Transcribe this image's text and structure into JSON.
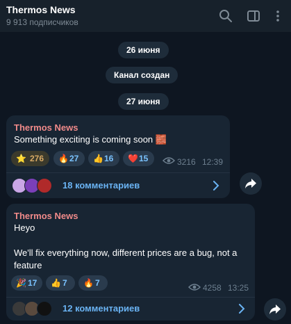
{
  "header": {
    "title": "Thermos News",
    "subtitle": "9 913 подписчиков",
    "icons": [
      "search-icon",
      "sidebar-toggle-icon",
      "more-vert-icon"
    ]
  },
  "date_pills": [
    "26 июня",
    "Канал создан",
    "27 июня"
  ],
  "messages": [
    {
      "sender": "Thermos News",
      "text": "Something exciting is coming soon 🧱",
      "reactions": [
        {
          "emoji": "⭐",
          "count": "276"
        },
        {
          "emoji": "🔥",
          "count": "27"
        },
        {
          "emoji": "👍",
          "count": "16"
        },
        {
          "emoji": "❤️",
          "count": "15"
        }
      ],
      "views": "3216",
      "time": "12:39",
      "comments": "18 комментариев"
    },
    {
      "sender": "Thermos News",
      "text_lines": [
        "Heyo",
        "",
        "We'll fix everything now, different prices are a bug, not a",
        "feature"
      ],
      "reactions": [
        {
          "emoji": "🎉",
          "count": "17"
        },
        {
          "emoji": "👍",
          "count": "7"
        },
        {
          "emoji": "🔥",
          "count": "7"
        }
      ],
      "views": "4258",
      "time": "13:25",
      "comments": "12 комментариев"
    }
  ],
  "colors": {
    "background": "#0e1621",
    "header": "#17212b",
    "bubble": "#182533",
    "sender": "#f08a8a",
    "link": "#6ab3f3",
    "star_reaction": "#d7a964"
  }
}
